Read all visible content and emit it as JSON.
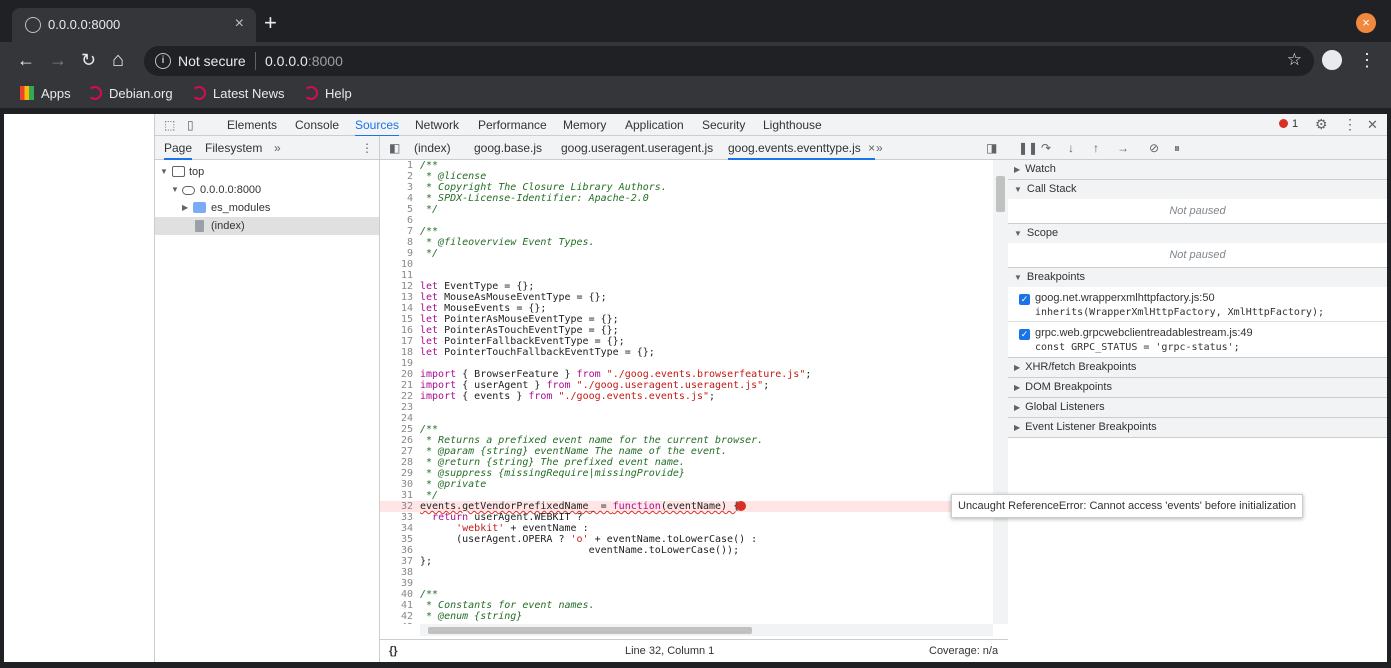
{
  "browser": {
    "tab_title": "0.0.0.0:8000",
    "tab_close": "×",
    "new_tab": "+",
    "window_close": "×",
    "back": "←",
    "forward": "→",
    "reload": "↻",
    "home": "⌂",
    "not_secure": "Not secure",
    "url_host": "0.0.0.0",
    "url_port": ":8000",
    "star": "☆",
    "menu": "⋮",
    "bookmarks": [
      "Apps",
      "Debian.org",
      "Latest News",
      "Help"
    ]
  },
  "devtools": {
    "tabs": [
      "Elements",
      "Console",
      "Sources",
      "Network",
      "Performance",
      "Memory",
      "Application",
      "Security",
      "Lighthouse"
    ],
    "active_tab": "Sources",
    "error_count": "1",
    "close": "✕",
    "settings": "⚙",
    "more": "⋮"
  },
  "navigator": {
    "tabs": [
      "Page",
      "Filesystem"
    ],
    "more": "»",
    "menu": "⋮",
    "tree": [
      {
        "label": "top"
      },
      {
        "label": "0.0.0.0:8000"
      },
      {
        "label": "es_modules"
      },
      {
        "label": "(index)"
      }
    ]
  },
  "editor": {
    "tabs": [
      "(index)",
      "goog.base.js",
      "goog.useragent.useragent.js",
      "goog.events.eventtype.js"
    ],
    "more": "»",
    "tab_close": "×",
    "lines": [
      {
        "n": "1",
        "t": "/**"
      },
      {
        "n": "2",
        "t": " * @license"
      },
      {
        "n": "3",
        "t": " * Copyright The Closure Library Authors."
      },
      {
        "n": "4",
        "t": " * SPDX-License-Identifier: Apache-2.0"
      },
      {
        "n": "5",
        "t": " */"
      },
      {
        "n": "6",
        "t": ""
      },
      {
        "n": "7",
        "t": "/**"
      },
      {
        "n": "8",
        "t": " * @fileoverview Event Types."
      },
      {
        "n": "9",
        "t": " */"
      },
      {
        "n": "10",
        "t": ""
      },
      {
        "n": "11",
        "t": ""
      },
      {
        "n": "12",
        "t": "let EventType = {};"
      },
      {
        "n": "13",
        "t": "let MouseAsMouseEventType = {};"
      },
      {
        "n": "14",
        "t": "let MouseEvents = {};"
      },
      {
        "n": "15",
        "t": "let PointerAsMouseEventType = {};"
      },
      {
        "n": "16",
        "t": "let PointerAsTouchEventType = {};"
      },
      {
        "n": "17",
        "t": "let PointerFallbackEventType = {};"
      },
      {
        "n": "18",
        "t": "let PointerTouchFallbackEventType = {};"
      },
      {
        "n": "19",
        "t": ""
      },
      {
        "n": "20",
        "t": "import { BrowserFeature } from \"./goog.events.browserfeature.js\";"
      },
      {
        "n": "21",
        "t": "import { userAgent } from \"./goog.useragent.useragent.js\";"
      },
      {
        "n": "22",
        "t": "import { events } from \"./goog.events.events.js\";"
      },
      {
        "n": "23",
        "t": ""
      },
      {
        "n": "24",
        "t": ""
      },
      {
        "n": "25",
        "t": "/**"
      },
      {
        "n": "26",
        "t": " * Returns a prefixed event name for the current browser."
      },
      {
        "n": "27",
        "t": " * @param {string} eventName The name of the event."
      },
      {
        "n": "28",
        "t": " * @return {string} The prefixed event name."
      },
      {
        "n": "29",
        "t": " * @suppress {missingRequire|missingProvide}"
      },
      {
        "n": "30",
        "t": " * @private"
      },
      {
        "n": "31",
        "t": " */"
      },
      {
        "n": "32",
        "t": "events.getVendorPrefixedName_ = function(eventName) {"
      },
      {
        "n": "33",
        "t": "  return userAgent.WEBKIT ?"
      },
      {
        "n": "34",
        "t": "      'webkit' + eventName :"
      },
      {
        "n": "35",
        "t": "      (userAgent.OPERA ? 'o' + eventName.toLowerCase() :"
      },
      {
        "n": "36",
        "t": "                            eventName.toLowerCase());"
      },
      {
        "n": "37",
        "t": "};"
      },
      {
        "n": "38",
        "t": ""
      },
      {
        "n": "39",
        "t": ""
      },
      {
        "n": "40",
        "t": "/**"
      },
      {
        "n": "41",
        "t": " * Constants for event names."
      },
      {
        "n": "42",
        "t": " * @enum {string}"
      },
      {
        "n": "43",
        "t": ""
      }
    ],
    "tooltip": "Uncaught ReferenceError: Cannot access 'events' before initialization",
    "footer_format": "{}",
    "cursor": "Line 32, Column 1",
    "coverage": "Coverage: n/a"
  },
  "debugger": {
    "sections": [
      "Watch",
      "Call Stack",
      "Scope",
      "Breakpoints",
      "XHR/fetch Breakpoints",
      "DOM Breakpoints",
      "Global Listeners",
      "Event Listener Breakpoints"
    ],
    "not_paused": "Not paused",
    "breakpoints": [
      {
        "file": "goog.net.wrapperxmlhttpfactory.js:50",
        "code": "inherits(WrapperXmlHttpFactory, XmlHttpFactory);"
      },
      {
        "file": "grpc.web.grpcwebclientreadablestream.js:49",
        "code": "const GRPC_STATUS = 'grpc-status';"
      }
    ]
  }
}
